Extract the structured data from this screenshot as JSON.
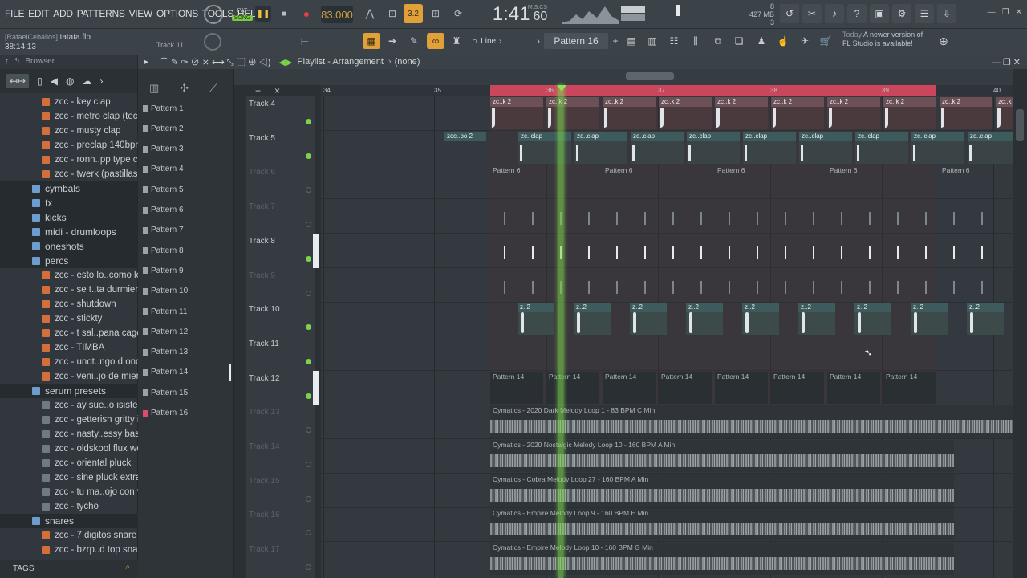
{
  "menu": [
    "FILE",
    "EDIT",
    "ADD",
    "PATTERNS",
    "VIEW",
    "OPTIONS",
    "TOOLS",
    "HELP"
  ],
  "transport": {
    "pat": "PAT",
    "song": "SONG",
    "tempo": "83.000",
    "time": "1:41",
    "time_sub": "60",
    "time_label": "M:S:CS"
  },
  "cpu": {
    "voices": "8",
    "ram": "427 MB",
    "cpu_count": "3"
  },
  "news": {
    "when": "Today",
    "text": "A newer version of FL Studio is available!"
  },
  "project": {
    "user": "[RafaelCeballos]",
    "file": "tatata.flp",
    "time": "38:14:13",
    "hint_track": "Track 11"
  },
  "snap": "Line",
  "pattern_selector": "Pattern 16",
  "browser": {
    "title": "Browser",
    "items": [
      {
        "t": "file",
        "label": "zcc - key clap"
      },
      {
        "t": "file",
        "label": "zcc - metro clap (teca)"
      },
      {
        "t": "file",
        "label": "zcc - musty clap"
      },
      {
        "t": "file",
        "label": "zcc - preclap 140bpm"
      },
      {
        "t": "file",
        "label": "zcc - ronn..pp type clap"
      },
      {
        "t": "file",
        "label": "zcc - twerk (pastillas)"
      },
      {
        "t": "folder",
        "label": "cymbals",
        "hl": true
      },
      {
        "t": "folder",
        "label": "fx",
        "hl": true
      },
      {
        "t": "folder",
        "label": "kicks",
        "hl": true
      },
      {
        "t": "folder",
        "label": "midi - drumloops",
        "hl": true
      },
      {
        "t": "folder",
        "label": "oneshots",
        "hl": true
      },
      {
        "t": "folder",
        "label": "percs",
        "hl": true
      },
      {
        "t": "file",
        "label": "zcc - esto lo..como loco"
      },
      {
        "t": "file",
        "label": "zcc - se t..ta durmiendo"
      },
      {
        "t": "file",
        "label": "zcc - shutdown"
      },
      {
        "t": "file",
        "label": "zcc - stickty"
      },
      {
        "t": "file",
        "label": "zcc - t sal..pana cagon"
      },
      {
        "t": "file",
        "label": "zcc - TIMBA"
      },
      {
        "t": "file",
        "label": "zcc - unot..ngo d onda."
      },
      {
        "t": "file",
        "label": "zcc - veni..jo de mierda"
      },
      {
        "t": "folder",
        "label": "serum presets",
        "hl": true
      },
      {
        "t": "vst",
        "label": "zcc - ay sue..o isisteeee"
      },
      {
        "t": "vst",
        "label": "zcc - getterish gritty iiii"
      },
      {
        "t": "vst",
        "label": "zcc - nasty..essy bass 2"
      },
      {
        "t": "vst",
        "label": "zcc - oldskool flux wob"
      },
      {
        "t": "vst",
        "label": "zcc - oriental pluck"
      },
      {
        "t": "vst",
        "label": "zcc - sine pluck extra"
      },
      {
        "t": "vst",
        "label": "zcc - tu ma..ojo con vos"
      },
      {
        "t": "vst",
        "label": "zcc - tycho"
      },
      {
        "t": "folder",
        "label": "snares",
        "hl": true
      },
      {
        "t": "file",
        "label": "zcc - 7 digitos snare"
      },
      {
        "t": "file",
        "label": "zcc - bzrp..d top snare"
      }
    ],
    "tags": "TAGS"
  },
  "patterns": [
    "Pattern 1",
    "Pattern 2",
    "Pattern 3",
    "Pattern 4",
    "Pattern 5",
    "Pattern 6",
    "Pattern 7",
    "Pattern 8",
    "Pattern 9",
    "Pattern 10",
    "Pattern 11",
    "Pattern 12",
    "Pattern 13",
    "Pattern 14",
    "Pattern 15",
    "Pattern 16"
  ],
  "playlist": {
    "title": "Playlist - Arrangement",
    "arrangement": "(none)",
    "ruler": [
      "34",
      "35",
      "36",
      "37",
      "38",
      "39",
      "40"
    ],
    "tracks": [
      {
        "name": "Track 4",
        "active": true
      },
      {
        "name": "Track 5",
        "active": true
      },
      {
        "name": "Track 6",
        "active": false
      },
      {
        "name": "Track 7",
        "active": false
      },
      {
        "name": "Track 8",
        "active": true,
        "bar": true
      },
      {
        "name": "Track 9",
        "active": false
      },
      {
        "name": "Track 10",
        "active": true
      },
      {
        "name": "Track 11",
        "active": true
      },
      {
        "name": "Track 12",
        "active": true,
        "bar": true
      },
      {
        "name": "Track 13",
        "active": false
      },
      {
        "name": "Track 14",
        "active": false
      },
      {
        "name": "Track 15",
        "active": false
      },
      {
        "name": "Track 16",
        "active": false
      },
      {
        "name": "Track 17",
        "active": false
      }
    ],
    "clip_labels": {
      "t4": "zc..k 2",
      "t5a": "zcc..bo 2",
      "t5": "zc..clap",
      "t6": "Pattern 6",
      "t10": "z..2",
      "t12": "Pattern 14",
      "a13": "Cymatics - 2020 Dark Melody Loop 1 - 83 BPM C Min",
      "a14": "Cymatics - 2020 Nostalgic Melody Loop 10 - 160 BPM A Min",
      "a15": "Cymatics - Cobra Melody Loop 27 - 160 BPM A Min",
      "a16": "Cymatics - Empire Melody Loop 9 - 160 BPM E Min",
      "a17": "Cymatics - Empire Melody Loop 10 - 160 BPM G Min"
    }
  },
  "colors": {
    "loop": "#c9465d",
    "playhead": "#7ed84d",
    "clip_red": "#5a3a40",
    "clip_teal": "#3d5a5c",
    "accent": "#7ac943"
  }
}
